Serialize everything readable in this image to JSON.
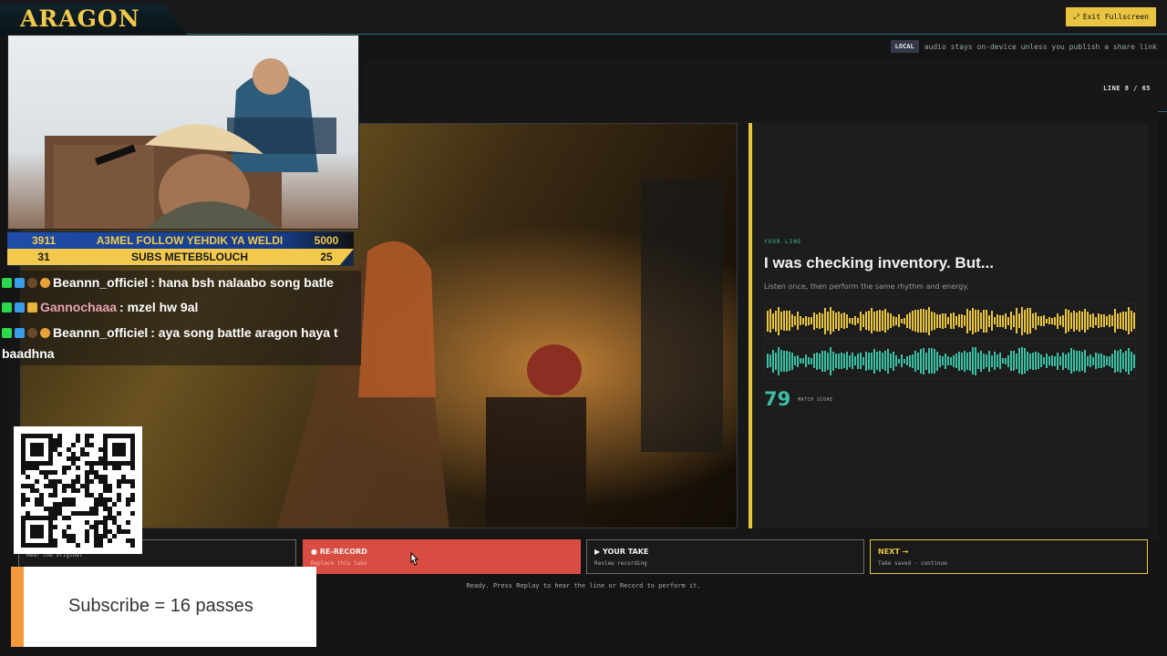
{
  "app": {
    "exit_fullscreen": "Exit Fullscreen",
    "local_badge": "LOCAL",
    "local_note": "audio stays on-device unless you publish a share link",
    "line_counter": "LINE 8 / 65"
  },
  "line_panel": {
    "label": "YOUR LINE",
    "text": "I was checking inventory. But...",
    "hint": "Listen once, then perform the same rhythm and energy.",
    "score": "79",
    "score_label": "MATCH SCORE"
  },
  "controls": {
    "replay": {
      "title": "",
      "subtitle": "Hear the original"
    },
    "rerecord": {
      "title": "● RE-RECORD",
      "subtitle": "Replace this take"
    },
    "yourtake": {
      "title": "▶ YOUR TAKE",
      "subtitle": "Review recording"
    },
    "next": {
      "title": "NEXT →",
      "subtitle": "Take saved · continue"
    }
  },
  "status": "Ready. Press Replay to hear the line or Record to perform it.",
  "overlay": {
    "logo": "ARAGON",
    "stats": {
      "row1_left": "3911",
      "row1_mid": "A3MEL FOLLOW YEHDIK YA WELDI",
      "row1_right": "5000",
      "row2_left": "31",
      "row2_mid": "SUBS METEB5LOUCH",
      "row2_right": "25"
    },
    "chat": [
      {
        "user": "Beannn_officiel",
        "text": ": hana bsh nalaabo song batle"
      },
      {
        "user": "Gannochaaa",
        "text": ": mzel hw 9al"
      },
      {
        "user": "Beannn_officiel",
        "text": ": aya song battle aragon haya t"
      },
      {
        "user": "",
        "text": "baadhna"
      }
    ],
    "subscribe": "Subscribe = 16 passes"
  },
  "colors": {
    "accent_yellow": "#e8c440",
    "accent_teal": "#3bbfa3",
    "record_red": "#d94c42"
  }
}
